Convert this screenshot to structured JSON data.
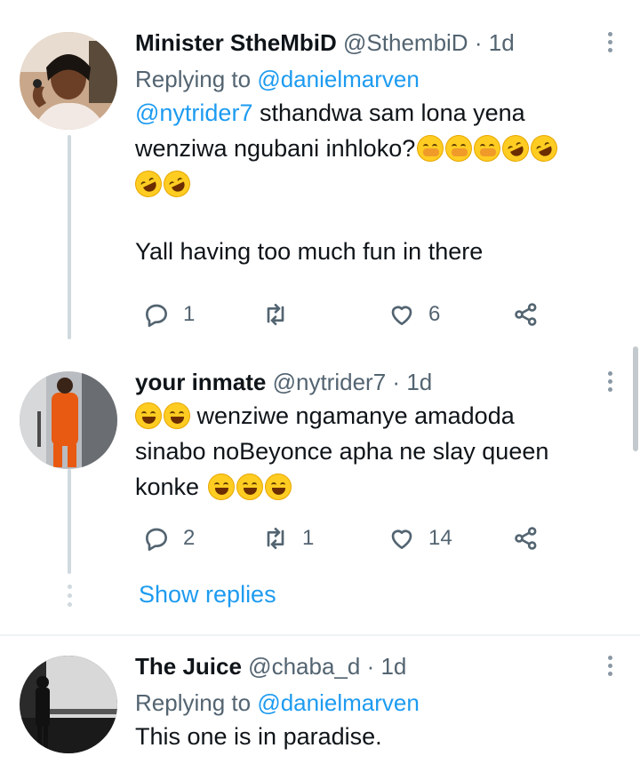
{
  "tweets": [
    {
      "name": "Minister StheMbiD",
      "handle": "@SthembiD",
      "time": "1d",
      "replying_prefix": "Replying to",
      "replying_to": "@danielmarven",
      "mention": "@nytrider7",
      "text_line1": " sthandwa sam lona yena",
      "text_line2": "wenziwa ngubani inhloko?",
      "text_line4": "Yall having too much fun in there",
      "emojis": [
        "hand-over-mouth-emoji",
        "rofl-emoji"
      ],
      "reply_count": "1",
      "retweet_count": "",
      "like_count": "6"
    },
    {
      "name": "your inmate",
      "handle": "@nytrider7",
      "time": "1d",
      "text_line1": " wenziwe ngamanye amadoda",
      "text_line2": "sinabo noBeyonce apha ne slay queen",
      "text_line3": "konke",
      "emojis": [
        "joy-emoji"
      ],
      "reply_count": "2",
      "retweet_count": "1",
      "like_count": "14"
    },
    {
      "name": "The Juice",
      "handle": "@chaba_d",
      "time": "1d",
      "replying_prefix": "Replying to",
      "replying_to": "@danielmarven",
      "text_line1": "This one is in paradise."
    }
  ],
  "show_replies_label": "Show replies",
  "separator": "·",
  "colors": {
    "accent": "#1d9bf0",
    "muted": "#536471",
    "text": "#0f1419",
    "line": "#cfd9de"
  }
}
